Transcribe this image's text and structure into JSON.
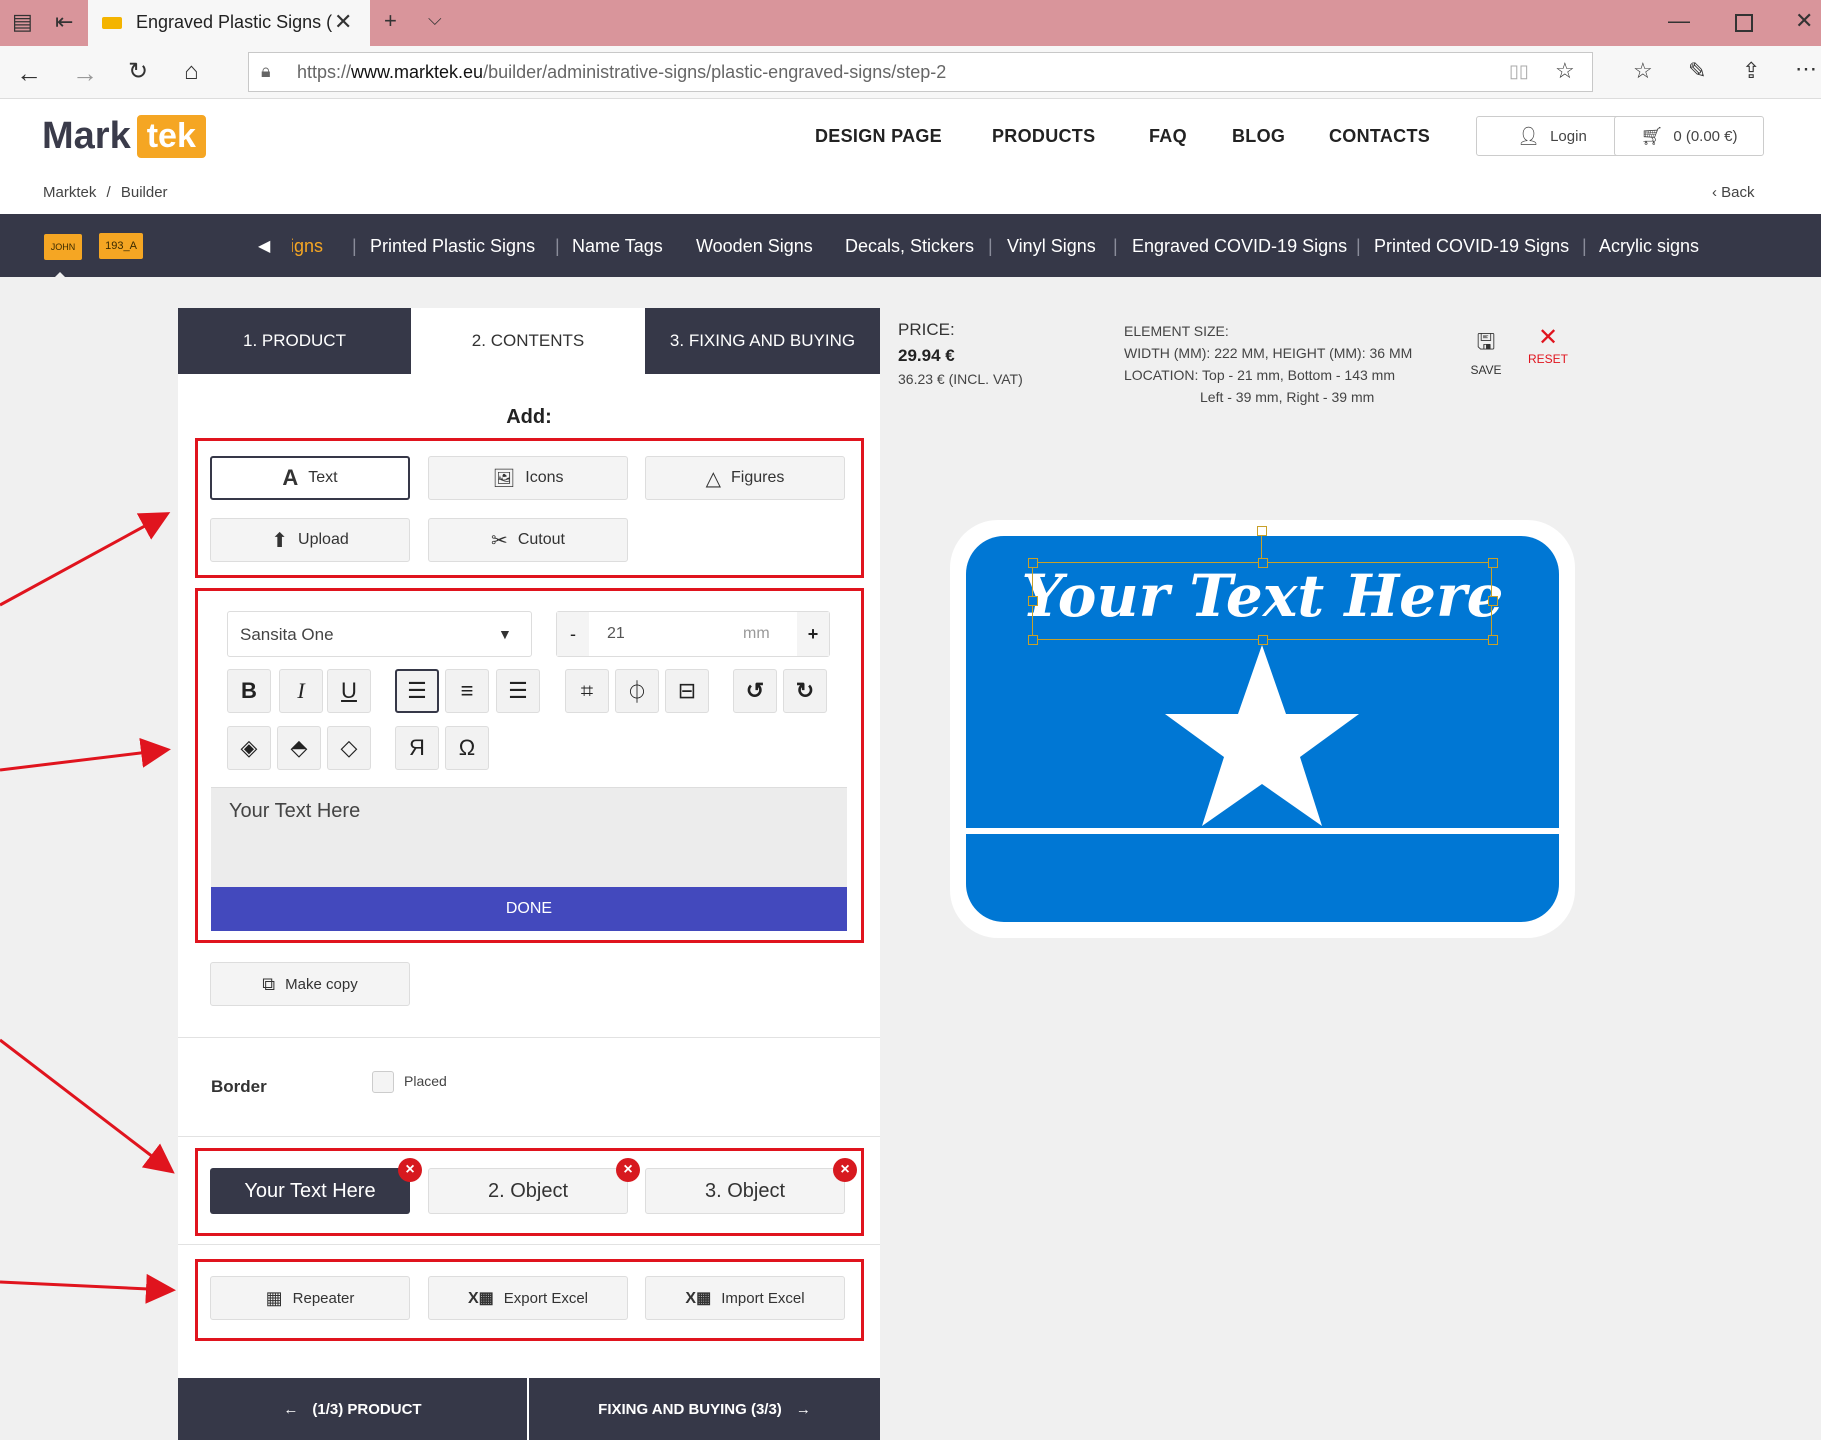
{
  "browser": {
    "tab_title": "Engraved Plastic Signs (",
    "url_prefix": "https://",
    "url_domain": "www.marktek.eu",
    "url_path": "/builder/administrative-signs/plastic-engraved-signs/step-2"
  },
  "header": {
    "logo_mark": "Mark",
    "logo_tek": "tek",
    "nav": [
      "DESIGN PAGE",
      "PRODUCTS",
      "FAQ",
      "BLOG",
      "CONTACTS"
    ],
    "login_label": "Login",
    "cart_label": "0 (0.00 €)",
    "breadcrumb_home": "Marktek",
    "breadcrumb_sep": "/",
    "breadcrumb_current": "Builder",
    "back_label": "Back"
  },
  "category_bar": {
    "badge1": "JOHN",
    "badge2": "193_A",
    "items": [
      "Signs",
      "Printed Plastic Signs",
      "Name Tags",
      "Wooden Signs",
      "Decals, Stickers",
      "Vinyl Signs",
      "Engraved COVID-19 Signs",
      "Printed COVID-19 Signs",
      "Acrylic signs"
    ]
  },
  "steps": [
    "1. PRODUCT",
    "2. CONTENTS",
    "3. FIXING AND BUYING"
  ],
  "add": {
    "title": "Add:",
    "buttons": [
      "Text",
      "Icons",
      "Figures",
      "Upload",
      "Cutout"
    ]
  },
  "editor": {
    "font": "Sansita One",
    "size_value": "21",
    "size_unit": "mm",
    "minus": "-",
    "plus": "+",
    "text_value": "Your Text Here",
    "done_label": "DONE"
  },
  "make_copy_label": "Make copy",
  "border": {
    "label": "Border",
    "checkbox_label": "Placed"
  },
  "objects": [
    "Your Text Here",
    "2. Object",
    "3. Object"
  ],
  "extra_buttons": [
    "Repeater",
    "Export Excel",
    "Import Excel"
  ],
  "footer": {
    "prev": "(1/3) PRODUCT",
    "next": "FIXING AND BUYING (3/3)"
  },
  "price": {
    "label": "PRICE:",
    "value": "29.94 €",
    "incl_vat": "36.23 € (INCL. VAT)"
  },
  "element_size": {
    "title": "ELEMENT SIZE:",
    "dims": "WIDTH (MM): 222 MM,  HEIGHT (MM): 36 MM",
    "location1": "LOCATION:  Top - 21 mm,  Bottom - 143 mm",
    "location2": "Left - 39 mm,  Right - 39 mm"
  },
  "actions": {
    "save": "SAVE",
    "reset": "RESET"
  },
  "preview": {
    "text": "Your Text Here",
    "sign_color": "#0077d4"
  },
  "colors": {
    "accent_done": "#4349bd",
    "dark": "#363848",
    "highlight": "#e0141e",
    "logo_orange": "#f5a623"
  }
}
